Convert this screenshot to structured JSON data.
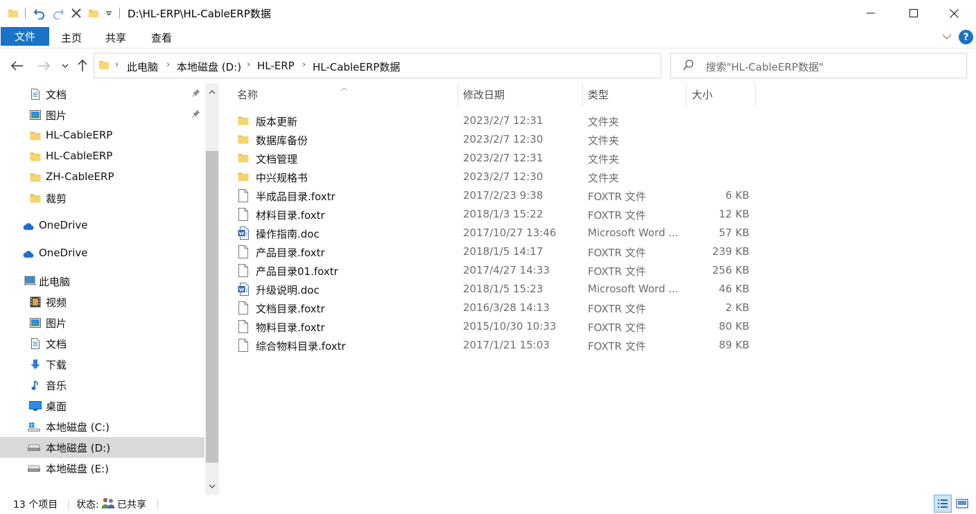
{
  "titlebar": {
    "title": "D:\\HL-ERP\\HL-CableERP数据",
    "icons": [
      "folder-icon",
      "undo-icon",
      "redo-icon",
      "delete-icon",
      "new-folder-icon",
      "qat-dropdown-icon"
    ],
    "window_buttons": [
      "minimize-icon",
      "maximize-icon",
      "close-icon"
    ]
  },
  "ribbon": {
    "tabs": [
      "文件",
      "主页",
      "共享",
      "查看"
    ],
    "expand_icon": "chevron-down-icon",
    "help_label": "?"
  },
  "address": {
    "crumbs": [
      "此电脑",
      "本地磁盘 (D:)",
      "HL-ERP",
      "HL-CableERP数据"
    ],
    "search_placeholder": "搜索\"HL-CableERP数据\""
  },
  "nav": {
    "items": [
      {
        "label": "文档",
        "icon": "documents-icon",
        "pinned": true
      },
      {
        "label": "图片",
        "icon": "pictures-icon",
        "pinned": true
      },
      {
        "label": "HL-CableERP",
        "icon": "folder-icon",
        "pinned": false
      },
      {
        "label": "HL-CableERP",
        "icon": "folder-icon",
        "pinned": false
      },
      {
        "label": "ZH-CableERP",
        "icon": "folder-icon",
        "pinned": false
      },
      {
        "label": "裁剪",
        "icon": "folder-icon",
        "pinned": false
      },
      {
        "label": "OneDrive",
        "icon": "onedrive-icon",
        "pinned": false
      },
      {
        "label": "OneDrive",
        "icon": "onedrive-icon",
        "pinned": false
      },
      {
        "label": "此电脑",
        "icon": "this-pc-icon",
        "pinned": false
      },
      {
        "label": "视频",
        "icon": "videos-icon",
        "pinned": false
      },
      {
        "label": "图片",
        "icon": "pictures-icon",
        "pinned": false
      },
      {
        "label": "文档",
        "icon": "documents-icon",
        "pinned": false
      },
      {
        "label": "下载",
        "icon": "downloads-icon",
        "pinned": false
      },
      {
        "label": "音乐",
        "icon": "music-icon",
        "pinned": false
      },
      {
        "label": "桌面",
        "icon": "desktop-icon",
        "pinned": false
      },
      {
        "label": "本地磁盘 (C:)",
        "icon": "windows-drive-icon",
        "pinned": false
      },
      {
        "label": "本地磁盘 (D:)",
        "icon": "drive-icon",
        "pinned": false,
        "selected": true
      },
      {
        "label": "本地磁盘 (E:)",
        "icon": "drive-icon",
        "pinned": false
      }
    ]
  },
  "files": {
    "columns": [
      "名称",
      "修改日期",
      "类型",
      "大小"
    ],
    "rows": [
      {
        "name": "版本更新",
        "date": "2023/2/7 12:31",
        "type": "文件夹",
        "size": "",
        "icon": "folder-icon"
      },
      {
        "name": "数据库备份",
        "date": "2023/2/7 12:30",
        "type": "文件夹",
        "size": "",
        "icon": "folder-icon"
      },
      {
        "name": "文档管理",
        "date": "2023/2/7 12:31",
        "type": "文件夹",
        "size": "",
        "icon": "folder-icon"
      },
      {
        "name": "中兴规格书",
        "date": "2023/2/7 12:30",
        "type": "文件夹",
        "size": "",
        "icon": "folder-icon"
      },
      {
        "name": "半成品目录.foxtr",
        "date": "2017/2/23 9:38",
        "type": "FOXTR 文件",
        "size": "6 KB",
        "icon": "file-icon"
      },
      {
        "name": "材料目录.foxtr",
        "date": "2018/1/3 15:22",
        "type": "FOXTR 文件",
        "size": "12 KB",
        "icon": "file-icon"
      },
      {
        "name": "操作指南.doc",
        "date": "2017/10/27 13:46",
        "type": "Microsoft Word ...",
        "size": "57 KB",
        "icon": "word-doc-icon"
      },
      {
        "name": "产品目录.foxtr",
        "date": "2018/1/5 14:17",
        "type": "FOXTR 文件",
        "size": "239 KB",
        "icon": "file-icon"
      },
      {
        "name": "产品目录01.foxtr",
        "date": "2017/4/27 14:33",
        "type": "FOXTR 文件",
        "size": "256 KB",
        "icon": "file-icon"
      },
      {
        "name": "升级说明.doc",
        "date": "2018/1/5 15:23",
        "type": "Microsoft Word ...",
        "size": "46 KB",
        "icon": "word-doc-icon"
      },
      {
        "name": "文档目录.foxtr",
        "date": "2016/3/28 14:13",
        "type": "FOXTR 文件",
        "size": "2 KB",
        "icon": "file-icon"
      },
      {
        "name": "物料目录.foxtr",
        "date": "2015/10/30 10:33",
        "type": "FOXTR 文件",
        "size": "80 KB",
        "icon": "file-icon"
      },
      {
        "name": "综合物料目录.foxtr",
        "date": "2017/1/21 15:03",
        "type": "FOXTR 文件",
        "size": "89 KB",
        "icon": "file-icon"
      }
    ]
  },
  "status": {
    "count": "13 个项目",
    "state_label": "状态:",
    "state_value": "已共享",
    "state_icon": "shared-users-icon",
    "views": [
      "details-view-icon",
      "large-icons-view-icon"
    ]
  },
  "colors": {
    "accent": "#1a73c6",
    "folder": "#f3c24a",
    "selected_nav": "#d9d9d9"
  }
}
